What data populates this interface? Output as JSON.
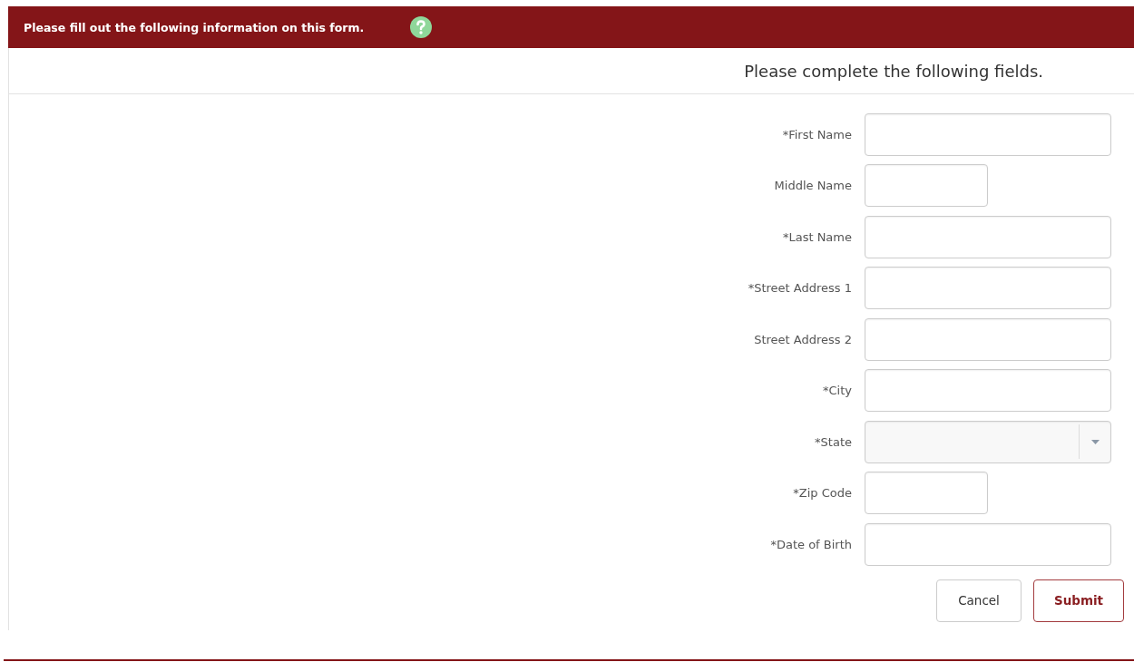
{
  "banner": {
    "title": "Please fill out the following information on this form."
  },
  "form": {
    "heading": "Please complete the following fields.",
    "fields": [
      {
        "label": "*First Name",
        "kind": "text"
      },
      {
        "label": "Middle Name",
        "kind": "short"
      },
      {
        "label": "*Last Name",
        "kind": "text"
      },
      {
        "label": "*Street Address 1",
        "kind": "text"
      },
      {
        "label": "Street Address 2",
        "kind": "text"
      },
      {
        "label": "*City",
        "kind": "text"
      },
      {
        "label": "*State",
        "kind": "select"
      },
      {
        "label": "*Zip Code",
        "kind": "short"
      },
      {
        "label": "*Date of Birth",
        "kind": "text"
      }
    ],
    "buttons": [
      {
        "label": "Cancel",
        "kind": "secondary"
      },
      {
        "label": "Submit",
        "kind": "primary"
      }
    ]
  }
}
